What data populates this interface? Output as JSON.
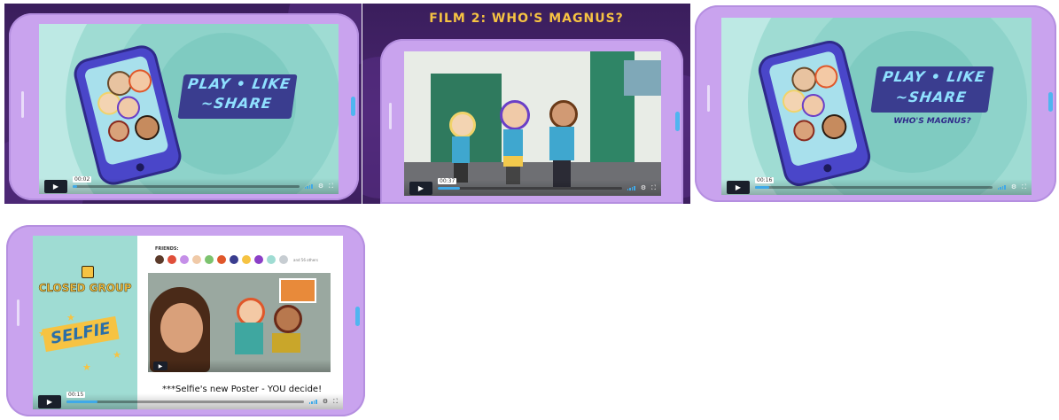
{
  "panels": [
    {
      "id": "panel-1",
      "logo": {
        "line1": "PLAY",
        "line2": "LIKE",
        "line3": "SHARE"
      },
      "player": {
        "time": "00:02",
        "progress": 0.02
      }
    },
    {
      "id": "panel-2",
      "title": "FILM 2: WHO'S MAGNUS?",
      "player": {
        "time": "00:37",
        "progress": 0.12
      }
    },
    {
      "id": "panel-3",
      "logo": {
        "line1": "PLAY",
        "line2": "LIKE",
        "line3": "SHARE"
      },
      "subtitle": "WHO'S MAGNUS?",
      "player": {
        "time": "00:16",
        "progress": 0.06
      }
    },
    {
      "id": "panel-4",
      "closed_group": "CLOSED GROUP",
      "selfie": "SELFIE",
      "friends_label": "FRIENDS:",
      "friends_more": "and 56 others",
      "caption": "***Selfie's new Poster - YOU decide!",
      "player": {
        "time": "00:15",
        "progress": 0.13
      }
    }
  ],
  "icons": {
    "play": "play-icon",
    "settings": "gear-icon",
    "fullscreen": "fullscreen-icon",
    "volume": "volume-icon"
  },
  "colors": {
    "tablet": "#c9a3ee",
    "accent": "#3fa9e8",
    "screen_bg": "#bde9e4",
    "logo_bg": "#3a3d8f",
    "title_yellow": "#f6c342"
  }
}
